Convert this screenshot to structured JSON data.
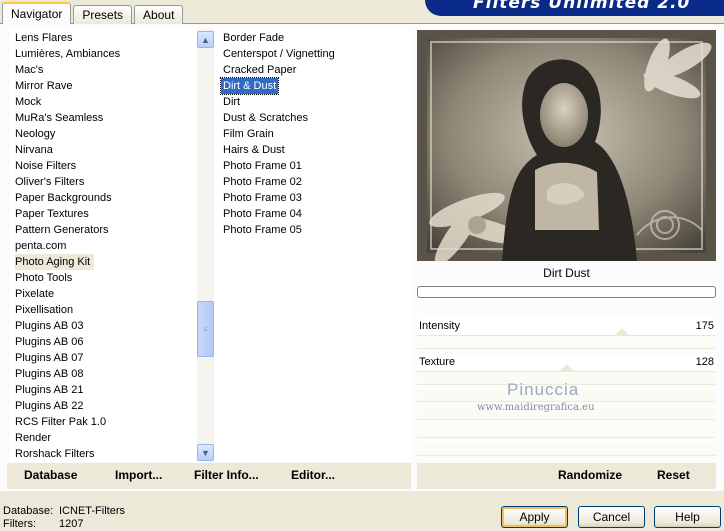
{
  "tabs": [
    {
      "label": "Navigator",
      "active": true
    },
    {
      "label": "Presets",
      "active": false
    },
    {
      "label": "About",
      "active": false
    }
  ],
  "brand": "Filters Unlimited 2.0",
  "categories": [
    "Lens Flares",
    "Lumières, Ambiances",
    "Mac's",
    "Mirror Rave",
    "Mock",
    "MuRa's Seamless",
    "Neology",
    "Nirvana",
    "Noise Filters",
    "Oliver's Filters",
    "Paper Backgrounds",
    "Paper Textures",
    "Pattern Generators",
    "penta.com",
    "Photo Aging Kit",
    "Photo Tools",
    "Pixelate",
    "Pixellisation",
    "Plugins AB 03",
    "Plugins AB 06",
    "Plugins AB 07",
    "Plugins AB 08",
    "Plugins AB 21",
    "Plugins AB 22",
    "RCS Filter Pak 1.0",
    "Render",
    "Rorshack Filters"
  ],
  "selected_category": "Photo Aging Kit",
  "filters": [
    "Border Fade",
    "Centerspot / Vignetting",
    "Cracked Paper",
    "Dirt & Dust",
    "Dirt",
    "Dust & Scratches",
    "Film Grain",
    "Hairs & Dust",
    "Photo Frame 01",
    "Photo Frame 02",
    "Photo Frame 03",
    "Photo Frame 04",
    "Photo Frame 05"
  ],
  "selected_filter": "Dirt & Dust",
  "preview": {
    "filter_name": "Dirt  Dust"
  },
  "sliders": [
    {
      "label": "Intensity",
      "value": "175",
      "level": 0.686
    },
    {
      "label": "Texture",
      "value": "128",
      "level": 0.502
    }
  ],
  "watermark": {
    "line1": "Pinuccia",
    "line2": "www.maidiregrafica.eu"
  },
  "left_buttons": {
    "database": "Database",
    "import": "Import...",
    "filter_info": "Filter Info...",
    "editor": "Editor..."
  },
  "right_buttons": {
    "randomize": "Randomize",
    "reset": "Reset"
  },
  "status": {
    "database_label": "Database:",
    "database_value": "ICNET-Filters",
    "filters_label": "Filters:",
    "filters_value": "1207"
  },
  "dialog_buttons": {
    "apply": "Apply",
    "cancel": "Cancel",
    "help": "Help"
  },
  "colors": {
    "selection": "#316ac5",
    "brand_bg": "#0a2a8a",
    "tab_highlight": "#ffc83c"
  }
}
